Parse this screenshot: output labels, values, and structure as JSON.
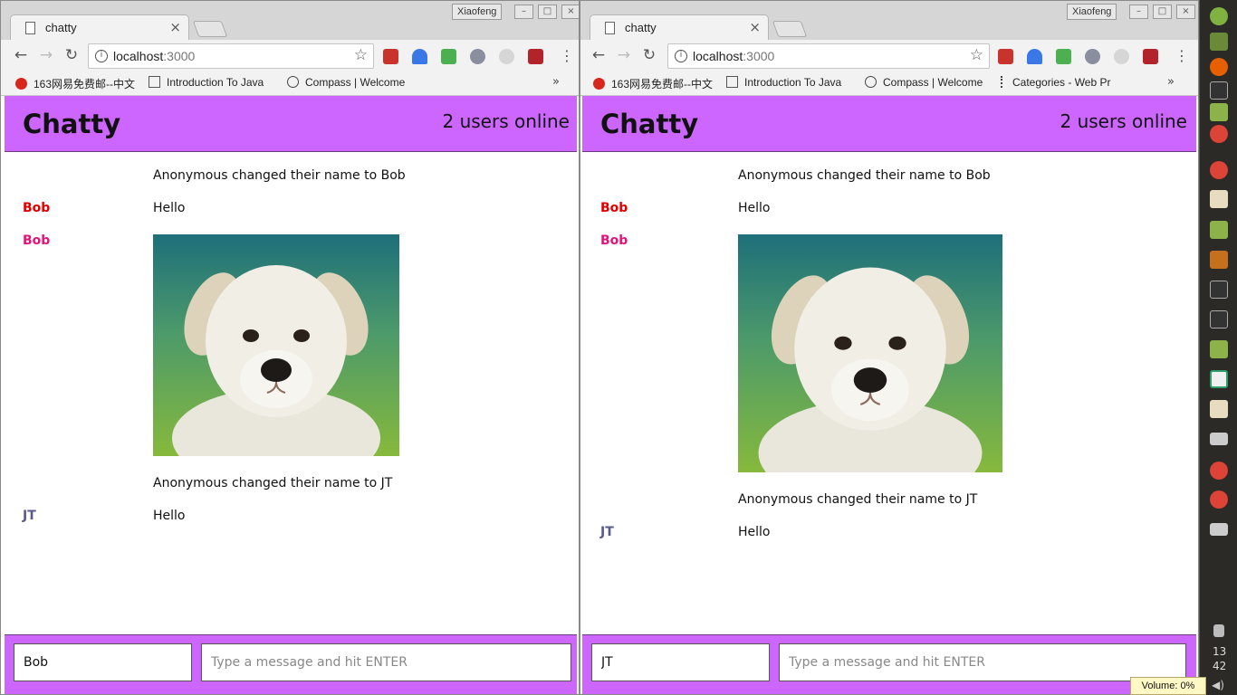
{
  "windows": [
    {
      "tab_title": "chatty",
      "user_badge": "Xiaofeng",
      "url_host": "localhost",
      "url_port": ":3000",
      "bookmarks": [
        "163网易免费邮--中文",
        "Introduction To Java",
        "Compass | Welcome"
      ],
      "app": {
        "brand": "Chatty",
        "online": "2 users online",
        "messages": [
          {
            "type": "notification",
            "text": "Anonymous changed their name to Bob"
          },
          {
            "type": "message",
            "user": "Bob",
            "user_color": "#e00000",
            "text": "Hello"
          },
          {
            "type": "image",
            "user": "Bob",
            "user_color": "#e0157a",
            "alt": "puppy"
          },
          {
            "type": "notification",
            "text": "Anonymous changed their name to JT"
          },
          {
            "type": "message",
            "user": "JT",
            "user_color": "#5a5a8a",
            "text": "Hello"
          }
        ],
        "username_value": "Bob",
        "message_placeholder": "Type a message and hit ENTER"
      }
    },
    {
      "tab_title": "chatty",
      "user_badge": "Xiaofeng",
      "url_host": "localhost",
      "url_port": ":3000",
      "bookmarks": [
        "163网易免费邮--中文",
        "Introduction To Java",
        "Compass | Welcome",
        "Categories - Web Pr"
      ],
      "app": {
        "brand": "Chatty",
        "online": "2 users online",
        "messages": [
          {
            "type": "notification",
            "text": "Anonymous changed their name to Bob"
          },
          {
            "type": "message",
            "user": "Bob",
            "user_color": "#e00000",
            "text": "Hello"
          },
          {
            "type": "image",
            "user": "Bob",
            "user_color": "#e0157a",
            "alt": "puppy"
          },
          {
            "type": "notification",
            "text": "Anonymous changed their name to JT"
          },
          {
            "type": "message",
            "user": "JT",
            "user_color": "#5a5a8a",
            "text": "Hello"
          }
        ],
        "username_value": "JT",
        "message_placeholder": "Type a message and hit ENTER"
      }
    }
  ],
  "system": {
    "clock_hour": "13",
    "clock_minute": "42",
    "volume": "Volume: 0%"
  },
  "colors": {
    "header_purple": "#cc66ff",
    "bob_text": "#e00000",
    "bob_image": "#e0157a",
    "jt": "#5a5a8a"
  }
}
